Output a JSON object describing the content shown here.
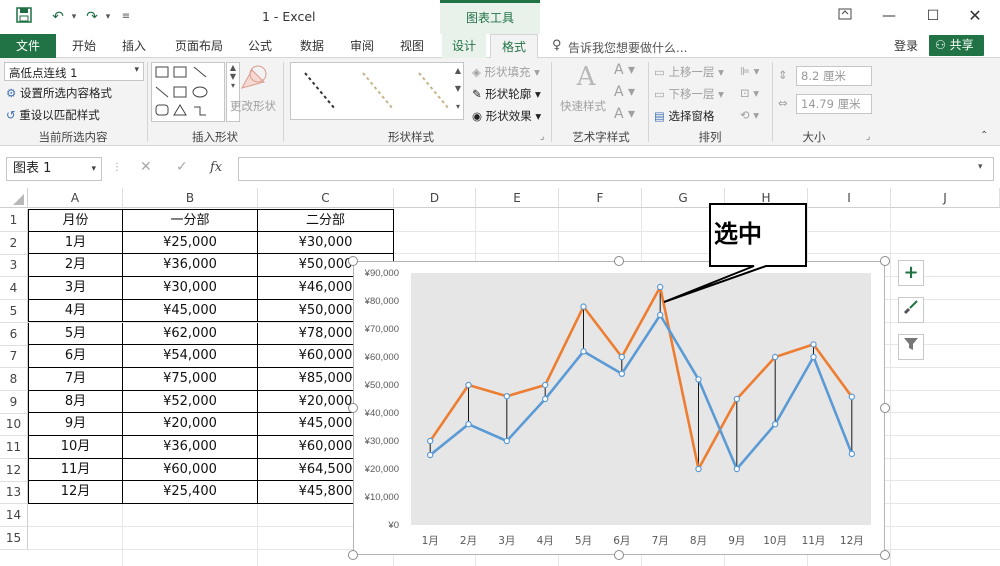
{
  "titlebar": {
    "title": "1 - Excel",
    "context_tab": "图表工具",
    "context_color": "#217346"
  },
  "tabs": {
    "file": "文件",
    "items": [
      "开始",
      "插入",
      "页面布局",
      "公式",
      "数据",
      "审阅",
      "视图",
      "设计",
      "格式"
    ],
    "active": "格式",
    "tell_me": "告诉我您想要做什么...",
    "login": "登录",
    "share": "共享"
  },
  "ribbon": {
    "current_selection": {
      "dropdown_value": "高低点连线 1",
      "format_selection": "设置所选内容格式",
      "reset_style": "重设以匹配样式",
      "label": "当前所选内容"
    },
    "insert_shapes": {
      "change_shape": "更改形状",
      "label": "插入形状"
    },
    "shape_styles": {
      "fill": "形状填充",
      "outline": "形状轮廓",
      "effects": "形状效果",
      "label": "形状样式"
    },
    "wordart": {
      "quick_styles": "快速样式",
      "label": "艺术字样式"
    },
    "arrange": {
      "bring_forward": "上移一层",
      "send_backward": "下移一层",
      "selection_pane": "选择窗格",
      "label": "排列"
    },
    "size": {
      "height": "8.2 厘米",
      "width": "14.79 厘米",
      "label": "大小"
    }
  },
  "formula_bar": {
    "name_box": "图表 1",
    "fx": "fx",
    "formula": ""
  },
  "sheet": {
    "columns": [
      "A",
      "B",
      "C",
      "D",
      "E",
      "F",
      "G",
      "H",
      "I",
      "J"
    ],
    "rows": [
      "1",
      "2",
      "3",
      "4",
      "5",
      "6",
      "7",
      "8",
      "9",
      "10",
      "11",
      "12",
      "13",
      "14",
      "15"
    ],
    "headers": [
      "月份",
      "一分部",
      "二分部"
    ],
    "data": [
      [
        "1月",
        "¥25,000",
        "¥30,000"
      ],
      [
        "2月",
        "¥36,000",
        "¥50,000"
      ],
      [
        "3月",
        "¥30,000",
        "¥46,000"
      ],
      [
        "4月",
        "¥45,000",
        "¥50,000"
      ],
      [
        "5月",
        "¥62,000",
        "¥78,000"
      ],
      [
        "6月",
        "¥54,000",
        "¥60,000"
      ],
      [
        "7月",
        "¥75,000",
        "¥85,000"
      ],
      [
        "8月",
        "¥52,000",
        "¥20,000"
      ],
      [
        "9月",
        "¥20,000",
        "¥45,000"
      ],
      [
        "10月",
        "¥36,000",
        "¥60,000"
      ],
      [
        "11月",
        "¥60,000",
        "¥64,500"
      ],
      [
        "12月",
        "¥25,400",
        "¥45,800"
      ]
    ]
  },
  "callout": {
    "text": "选中"
  },
  "chart_data": {
    "type": "line",
    "categories": [
      "1月",
      "2月",
      "3月",
      "4月",
      "5月",
      "6月",
      "7月",
      "8月",
      "9月",
      "10月",
      "11月",
      "12月"
    ],
    "series": [
      {
        "values": [
          25000,
          36000,
          30000,
          45000,
          62000,
          54000,
          75000,
          52000,
          20000,
          36000,
          60000,
          25400
        ],
        "color": "#5b9bd5"
      },
      {
        "values": [
          30000,
          50000,
          46000,
          50000,
          78000,
          60000,
          85000,
          20000,
          45000,
          60000,
          64500,
          45800
        ],
        "color": "#ed7d31"
      }
    ],
    "y_ticks": [
      "¥0",
      "¥10,000",
      "¥20,000",
      "¥30,000",
      "¥40,000",
      "¥50,000",
      "¥60,000",
      "¥70,000",
      "¥80,000",
      "¥90,000"
    ],
    "ylim": [
      0,
      90000
    ],
    "high_low_lines": true,
    "plot_background": "#e7e6e6"
  }
}
